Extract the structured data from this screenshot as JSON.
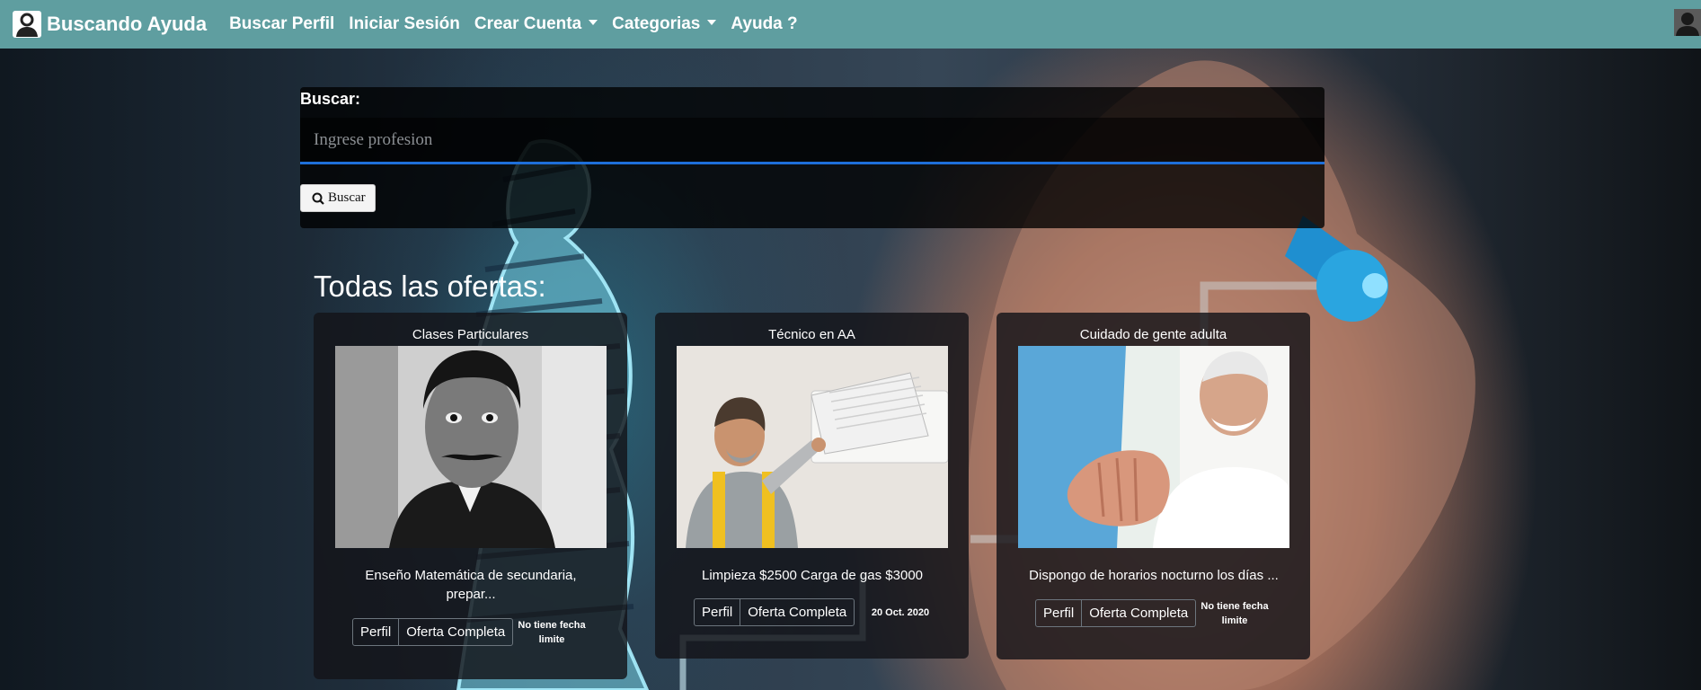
{
  "navbar": {
    "brand": "Buscando Ayuda",
    "items": [
      {
        "label": "Buscar Perfil"
      },
      {
        "label": "Iniciar Sesión"
      },
      {
        "label": "Crear Cuenta"
      },
      {
        "label": "Categorias"
      },
      {
        "label": "Ayuda ?"
      }
    ],
    "background_color": "#5f9ea0"
  },
  "search": {
    "label": "Buscar:",
    "placeholder": "Ingrese profesion",
    "value": "",
    "button_label": "Buscar",
    "underline_color": "#1e6fd9"
  },
  "offers": {
    "title": "Todas las ofertas:",
    "cards": [
      {
        "title": "Clases Particulares",
        "description": "Enseño Matemática de secundaria, prepar...",
        "profile_label": "Perfil",
        "full_offer_label": "Oferta Completa",
        "date_label": "No tiene fecha limite"
      },
      {
        "title": "Técnico en AA",
        "description": "Limpieza $2500 Carga de gas $3000",
        "profile_label": "Perfil",
        "full_offer_label": "Oferta Completa",
        "date_label": "20 Oct. 2020"
      },
      {
        "title": "Cuidado de gente adulta",
        "description": "Dispongo de horarios nocturno los días ...",
        "profile_label": "Perfil",
        "full_offer_label": "Oferta Completa",
        "date_label": "No tiene fecha limite"
      }
    ]
  }
}
